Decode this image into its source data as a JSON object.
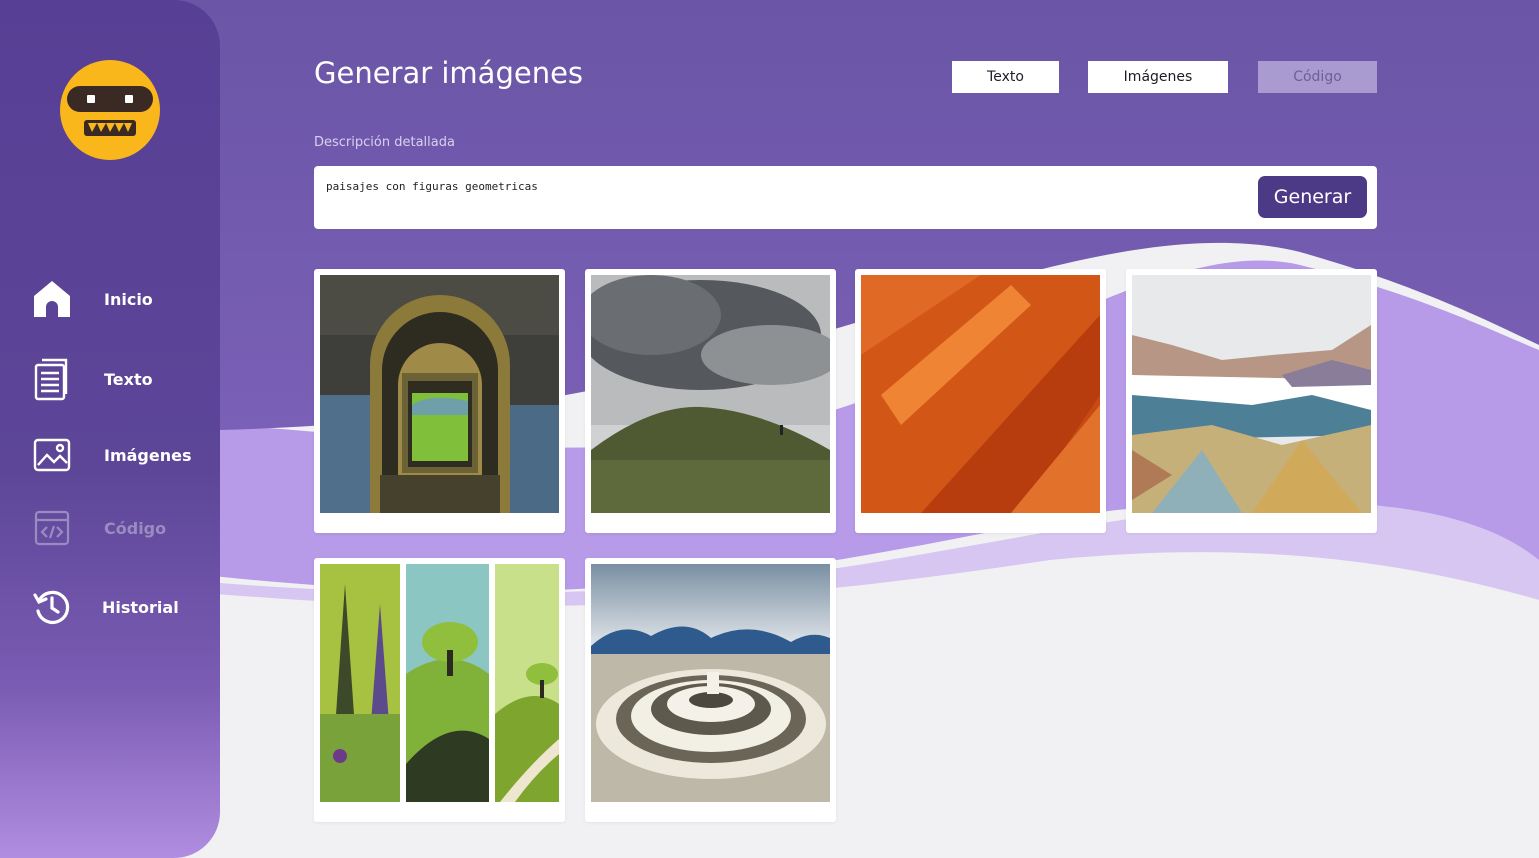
{
  "app": {
    "logo": "robot-face-logo"
  },
  "colors": {
    "header_purple": "#6a55a7",
    "sidebar_purple": "#573f95",
    "accent_button": "#4d3a86",
    "logo_yellow": "#f9b71b",
    "wave_lavender": "#b79ae8"
  },
  "sidebar": {
    "items": [
      {
        "label": "Inicio",
        "icon": "home-icon",
        "disabled": false
      },
      {
        "label": "Texto",
        "icon": "document-icon",
        "disabled": false
      },
      {
        "label": "Imágenes",
        "icon": "image-icon",
        "disabled": false
      },
      {
        "label": "Código",
        "icon": "code-icon",
        "disabled": true
      },
      {
        "label": "Historial",
        "icon": "history-icon",
        "disabled": false
      }
    ]
  },
  "header": {
    "title": "Generar imágenes",
    "tabs": [
      {
        "label": "Texto",
        "disabled": false
      },
      {
        "label": "Imágenes",
        "disabled": false
      },
      {
        "label": "Código",
        "disabled": true
      }
    ]
  },
  "prompt": {
    "label": "Descripción detallada",
    "value": "paisajes con figuras geometricas",
    "button_label": "Generar"
  },
  "gallery": {
    "images": [
      {
        "subject": "stone archway framing a green valley"
      },
      {
        "subject": "grassy hill under storm clouds"
      },
      {
        "subject": "orange geometric sand dunes"
      },
      {
        "subject": "low-poly coastal cliffs and bay"
      },
      {
        "subject": "triptych of stylized forest and trees"
      },
      {
        "subject": "spiral labyrinth with blue mountains"
      }
    ]
  }
}
